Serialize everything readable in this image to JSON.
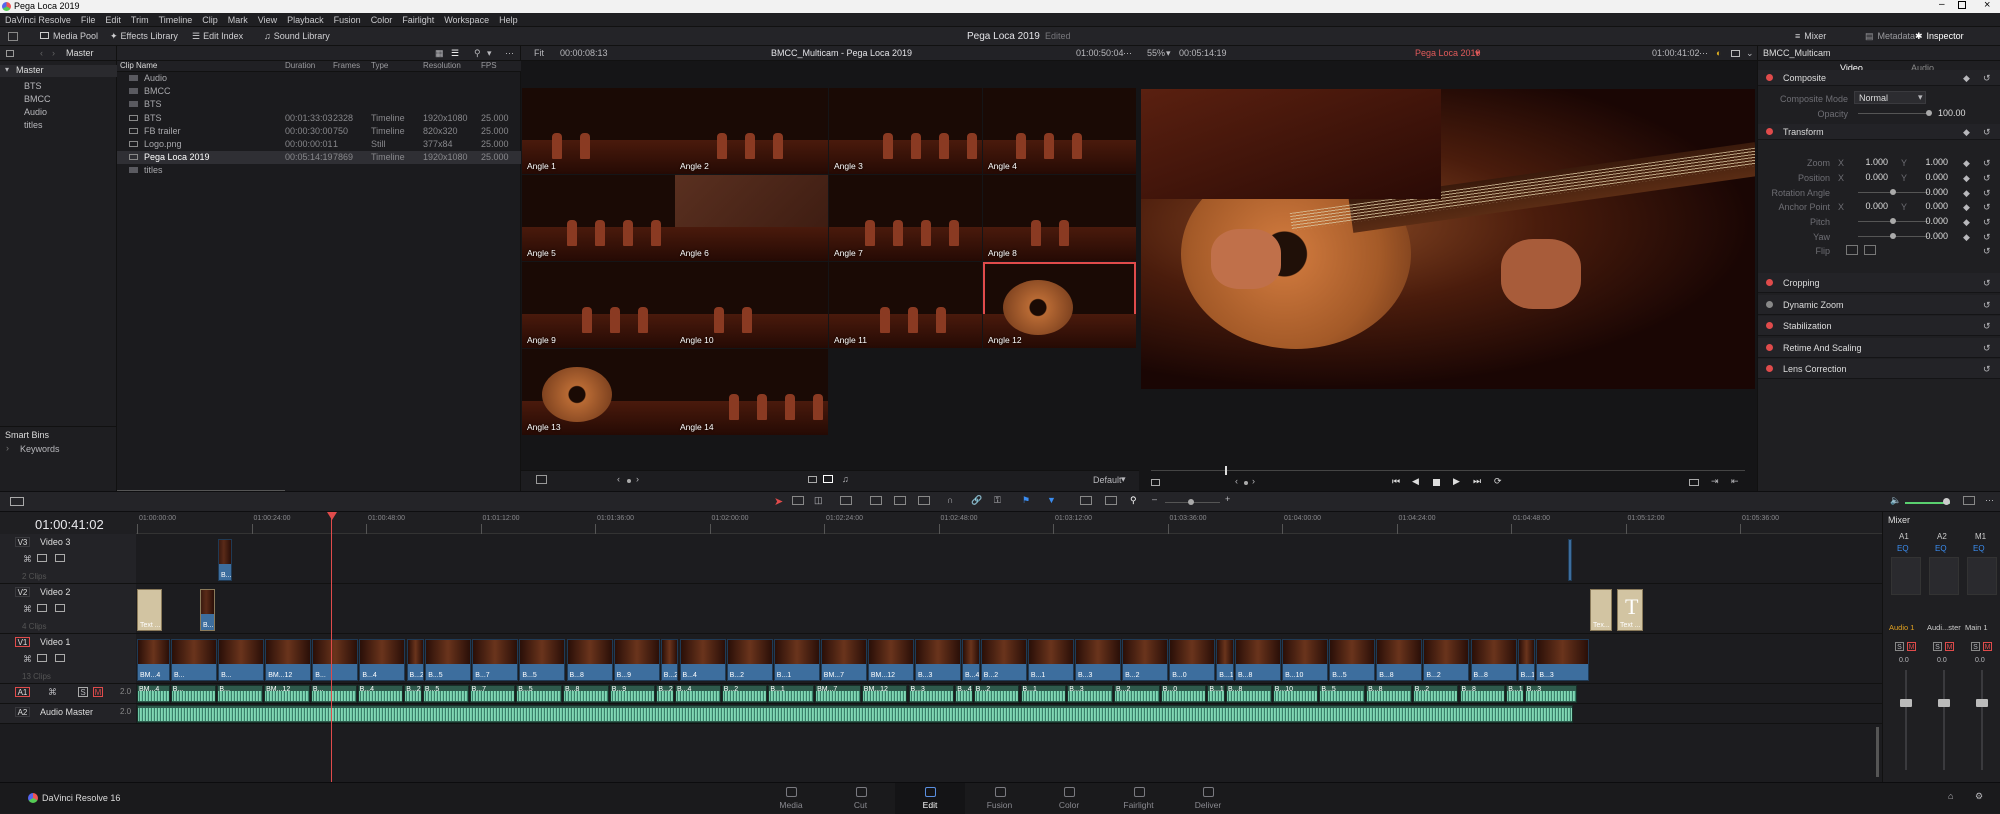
{
  "app": {
    "title": "Pega Loca 2019",
    "version_label": "DaVinci Resolve 16"
  },
  "menu": [
    "DaVinci Resolve",
    "File",
    "Edit",
    "Trim",
    "Timeline",
    "Clip",
    "Mark",
    "View",
    "Playback",
    "Fusion",
    "Color",
    "Fairlight",
    "Workspace",
    "Help"
  ],
  "toolbar": {
    "media_pool": "Media Pool",
    "effects_library": "Effects Library",
    "edit_index": "Edit Index",
    "sound_library": "Sound Library",
    "project_title": "Pega Loca 2019",
    "project_status": "Edited",
    "mixer": "Mixer",
    "metadata": "Metadata",
    "inspector": "Inspector"
  },
  "bins": {
    "header": "Master",
    "root": "Master",
    "items": [
      "BTS",
      "BMCC",
      "Audio",
      "titles"
    ],
    "smart_bins": "Smart Bins",
    "keywords": "Keywords"
  },
  "media": {
    "columns": [
      "Clip Name",
      "Duration",
      "Frames",
      "Type",
      "Resolution",
      "FPS"
    ],
    "rows": [
      {
        "name": "Audio",
        "duration": "",
        "frames": "",
        "type": "",
        "resolution": "",
        "fps": "",
        "kind": "folder"
      },
      {
        "name": "BMCC",
        "duration": "",
        "frames": "",
        "type": "",
        "resolution": "",
        "fps": "",
        "kind": "folder"
      },
      {
        "name": "BTS",
        "duration": "",
        "frames": "",
        "type": "",
        "resolution": "",
        "fps": "",
        "kind": "folder"
      },
      {
        "name": "BTS",
        "duration": "00:01:33:03",
        "frames": "2328",
        "type": "Timeline",
        "resolution": "1920x1080",
        "fps": "25.000",
        "kind": "timeline"
      },
      {
        "name": "FB trailer",
        "duration": "00:00:30:00",
        "frames": "750",
        "type": "Timeline",
        "resolution": "820x320",
        "fps": "25.000",
        "kind": "timeline"
      },
      {
        "name": "Logo.png",
        "duration": "00:00:00:01",
        "frames": "1",
        "type": "Still",
        "resolution": "377x84",
        "fps": "25.000",
        "kind": "still"
      },
      {
        "name": "Pega Loca 2019",
        "duration": "00:05:14:19",
        "frames": "7869",
        "type": "Timeline",
        "resolution": "1920x1080",
        "fps": "25.000",
        "kind": "timeline"
      },
      {
        "name": "titles",
        "duration": "",
        "frames": "",
        "type": "",
        "resolution": "",
        "fps": "",
        "kind": "folder"
      }
    ]
  },
  "source_viewer": {
    "fit": "Fit",
    "timecode": "00:00:08:13",
    "title": "BMCC_Multicam - Pega Loca 2019",
    "end_timecode": "01:00:50:04",
    "angle_sort": "Default"
  },
  "angles": [
    "Angle 1",
    "Angle 2",
    "Angle 3",
    "Angle 4",
    "Angle 5",
    "Angle 6",
    "Angle 7",
    "Angle 8",
    "Angle 9",
    "Angle 10",
    "Angle 11",
    "Angle 12",
    "Angle 13",
    "Angle 14"
  ],
  "selected_angle": "Angle 12",
  "timeline_viewer": {
    "zoom": "55%",
    "timecode": "00:05:14:19",
    "title": "Pega Loca 2019",
    "current_timecode": "01:00:41:02"
  },
  "inspector": {
    "clip": "BMCC_Multicam",
    "tabs": [
      "Video",
      "Audio"
    ],
    "composite": {
      "section": "Composite",
      "mode_label": "Composite Mode",
      "mode": "Normal",
      "opacity_label": "Opacity",
      "opacity": "100.00"
    },
    "transform": {
      "section": "Transform",
      "zoom_label": "Zoom",
      "zoom_x": "1.000",
      "zoom_y": "1.000",
      "position_label": "Position",
      "position_x": "0.000",
      "position_y": "0.000",
      "rotation_label": "Rotation Angle",
      "rotation": "0.000",
      "anchor_label": "Anchor Point",
      "anchor_x": "0.000",
      "anchor_y": "0.000",
      "pitch_label": "Pitch",
      "pitch": "0.000",
      "yaw_label": "Yaw",
      "yaw": "0.000",
      "flip_label": "Flip",
      "x": "X",
      "y": "Y"
    },
    "sections": [
      "Cropping",
      "Dynamic Zoom",
      "Stabilization",
      "Retime And Scaling",
      "Lens Correction"
    ]
  },
  "timeline": {
    "timecode": "01:00:41:02",
    "ruler": [
      "01:00:00:00",
      "01:00:24:00",
      "01:00:48:00",
      "01:01:12:00",
      "01:01:36:00",
      "01:02:00:00",
      "01:02:24:00",
      "01:02:48:00",
      "01:03:12:00",
      "01:03:36:00",
      "01:04:00:00",
      "01:04:24:00",
      "01:04:48:00",
      "01:05:12:00",
      "01:05:36:00"
    ],
    "tracks": {
      "v3": {
        "id": "V3",
        "name": "Video 3",
        "count": "2 Clips"
      },
      "v2": {
        "id": "V2",
        "name": "Video 2",
        "count": "4 Clips"
      },
      "v1": {
        "id": "V1",
        "name": "Video 1",
        "count": "13 Clips"
      },
      "a1": {
        "id": "A1",
        "level": "2.0"
      },
      "a2": {
        "id": "A2",
        "name": "Audio Master",
        "level": "2.0"
      }
    },
    "v2_clips": [
      "Text ...",
      "B...",
      "Tex...",
      "Text ..."
    ],
    "v3_clips": [
      "B..."
    ],
    "v1_labels": [
      "BM...4",
      "B...",
      "B...",
      "BM...12",
      "B...",
      "B...4",
      "B...2",
      "B...5",
      "B...7",
      "B...5",
      "B...8",
      "B...9",
      "B...2",
      "B...4",
      "B...2",
      "B...1",
      "BM...7",
      "BM...12",
      "B...3",
      "B...4",
      "B...2",
      "B...1",
      "B...3",
      "B...2",
      "B...0",
      "B...1",
      "B...8",
      "B...10",
      "B...5",
      "B...8",
      "B...2",
      "B...8",
      "B...1",
      "B...3"
    ]
  },
  "mixer": {
    "title": "Mixer",
    "channels": [
      "A1",
      "A2",
      "M1"
    ],
    "eq": "EQ",
    "names": [
      "Audio 1",
      "Audi...ster",
      "Main 1"
    ],
    "db": "0.0"
  },
  "pages": [
    "Media",
    "Cut",
    "Edit",
    "Fusion",
    "Color",
    "Fairlight",
    "Deliver"
  ],
  "active_page": "Edit",
  "colors": {
    "accent_red": "#e04b4b",
    "clip_blue": "#3d6e9e",
    "audio_green": "#2e5a4c",
    "page_active": "#5a8fe0"
  }
}
